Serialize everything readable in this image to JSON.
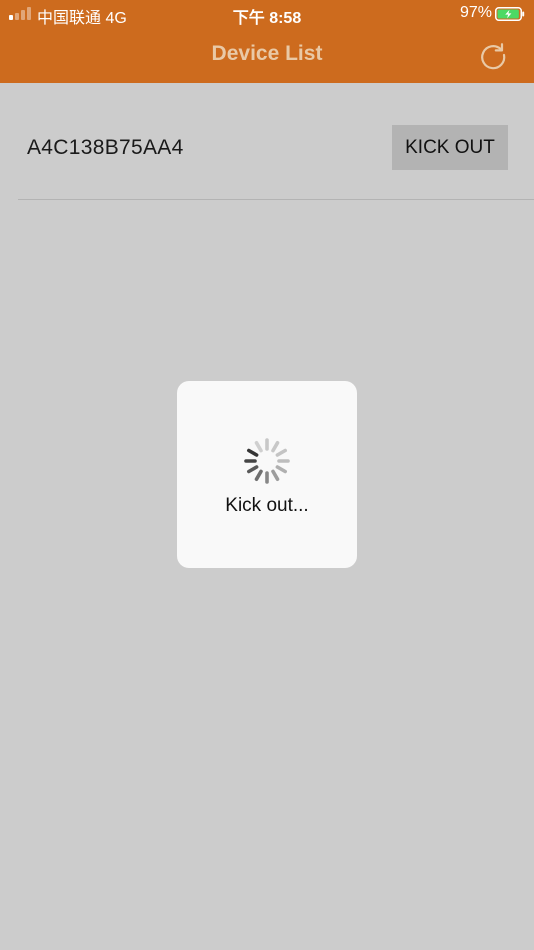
{
  "status_bar": {
    "carrier": "中国联通  4G",
    "time": "下午 8:58",
    "battery_percent": "97%",
    "signal_bars_filled": 1,
    "signal_bars_total": 4,
    "battery_level": 0.97,
    "battery_charging": true
  },
  "nav": {
    "title": "Device List",
    "refresh_icon": "refresh-icon"
  },
  "devices": [
    {
      "id": "A4C138B75AA4",
      "action_label": "KICK OUT"
    }
  ],
  "loading": {
    "label": "Kick out...",
    "icon": "spinner-icon"
  },
  "colors": {
    "accent": "#cd6b1e",
    "title_text": "#e9c9a6",
    "background": "#cccccc",
    "button_bg": "#b3b3b3",
    "hud_bg": "#f9f9f9",
    "battery_fill": "#4cd964"
  }
}
